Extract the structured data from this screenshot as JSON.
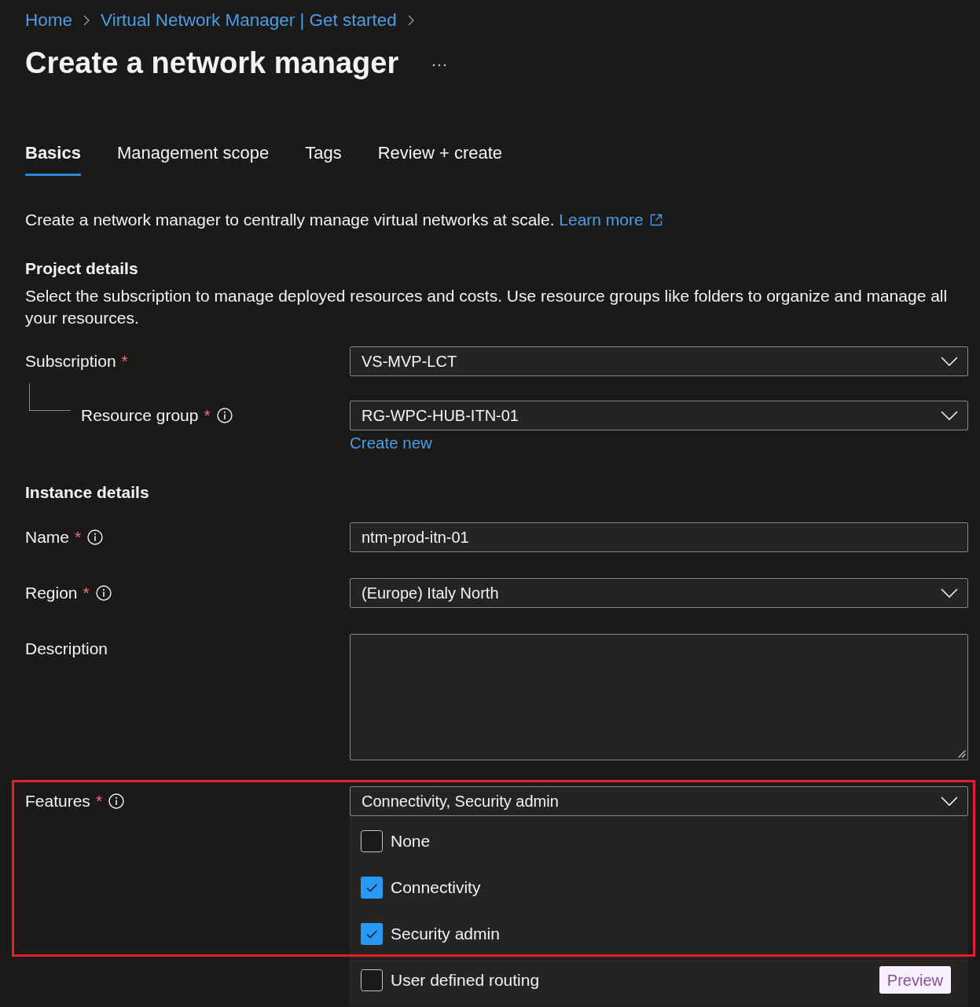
{
  "breadcrumb": [
    {
      "label": "Home"
    },
    {
      "label": "Virtual Network Manager | Get started"
    }
  ],
  "title": "Create a network manager",
  "tabs": [
    {
      "label": "Basics",
      "selected": true
    },
    {
      "label": "Management scope",
      "selected": false
    },
    {
      "label": "Tags",
      "selected": false
    },
    {
      "label": "Review + create",
      "selected": false
    }
  ],
  "intro": {
    "text": "Create a network manager to centrally manage virtual networks at scale.",
    "link": "Learn more"
  },
  "sections": [
    {
      "heading": "Project details",
      "description": "Select the subscription to manage deployed resources and costs. Use resource groups like folders to organize and manage all your resources.",
      "fields": [
        {
          "kind": "dropdown",
          "label": "Subscription",
          "required_mark": "*",
          "info": false,
          "value": "VS-MVP-LCT",
          "children": [
            {
              "kind": "dropdown",
              "label": "Resource group",
              "required_mark": "*",
              "info": true,
              "value": "RG-WPC-HUB-ITN-01",
              "link": "Create new"
            }
          ]
        }
      ]
    },
    {
      "heading": "Instance details",
      "fields": [
        {
          "kind": "text",
          "label": "Name",
          "required_mark": "*",
          "info": true,
          "value": "ntm-prod-itn-01"
        },
        {
          "kind": "dropdown",
          "label": "Region",
          "required_mark": "*",
          "info": true,
          "value": "(Europe) Italy North"
        },
        {
          "kind": "textarea",
          "label": "Description",
          "info": false
        },
        {
          "kind": "multiselect",
          "label": "Features",
          "required_mark": "*",
          "info": true,
          "value": "Connectivity, Security admin",
          "expanded": true,
          "highlighted": true,
          "options": [
            {
              "label": "None",
              "checked": false
            },
            {
              "label": "Connectivity",
              "checked": true
            },
            {
              "label": "Security admin",
              "checked": true
            },
            {
              "label": "User defined routing",
              "checked": false,
              "badge": "Preview"
            }
          ]
        }
      ]
    }
  ]
}
